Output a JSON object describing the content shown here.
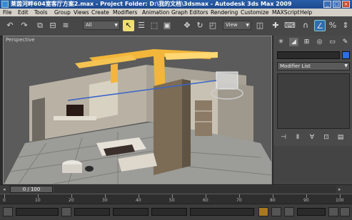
{
  "window": {
    "title": "莱茵河畔604室客厅方案2.max    - Project Folder: D:\\我的文档\\3dsmax    - Autodesk 3ds Max  2009",
    "buttons": {
      "minimize": "_",
      "maximize": "□",
      "close": "×"
    }
  },
  "menu": {
    "items": [
      "File",
      "Edit",
      "Tools",
      "Group",
      "Views",
      "Create",
      "Modifiers",
      "Animation",
      "Graph Editors",
      "Rendering",
      "Customize",
      "MAXScript",
      "Help"
    ]
  },
  "toolbar": {
    "selection_filter": "All",
    "reference_coord": "View",
    "icons": [
      "undo-icon",
      "redo-icon",
      "select-link-icon",
      "unlink-icon",
      "bind-space-warp-icon",
      "select-object-icon",
      "select-by-name-icon",
      "rectangular-region-icon",
      "window-crossing-icon",
      "move-icon",
      "rotate-icon",
      "scale-icon",
      "pivot-icon",
      "manipulate-icon",
      "keyboard-shortcut-icon",
      "snap-icon",
      "angle-snap-icon",
      "percent-snap-icon",
      "spinner-snap-icon"
    ]
  },
  "viewport": {
    "label": "Perspective"
  },
  "command_panel": {
    "tabs": [
      "create-tab-icon",
      "modify-tab-icon",
      "hierarchy-tab-icon",
      "motion-tab-icon",
      "display-tab-icon",
      "utilities-tab-icon"
    ],
    "modifier_list": "Modifier List",
    "swatch_color": "#2e6ee0",
    "stack_tools": [
      "pin-stack-icon",
      "show-end-result-icon",
      "make-unique-icon",
      "remove-modifier-icon",
      "configure-modifier-sets-icon"
    ]
  },
  "timeline": {
    "position": "0 / 100",
    "ruler_labels": [
      "0",
      "10",
      "20",
      "30",
      "40",
      "50",
      "60",
      "70",
      "80",
      "90",
      "100"
    ]
  },
  "colors": {
    "ceiling_light": "#f2b63a",
    "accent_blue": "#2d6fb0"
  }
}
